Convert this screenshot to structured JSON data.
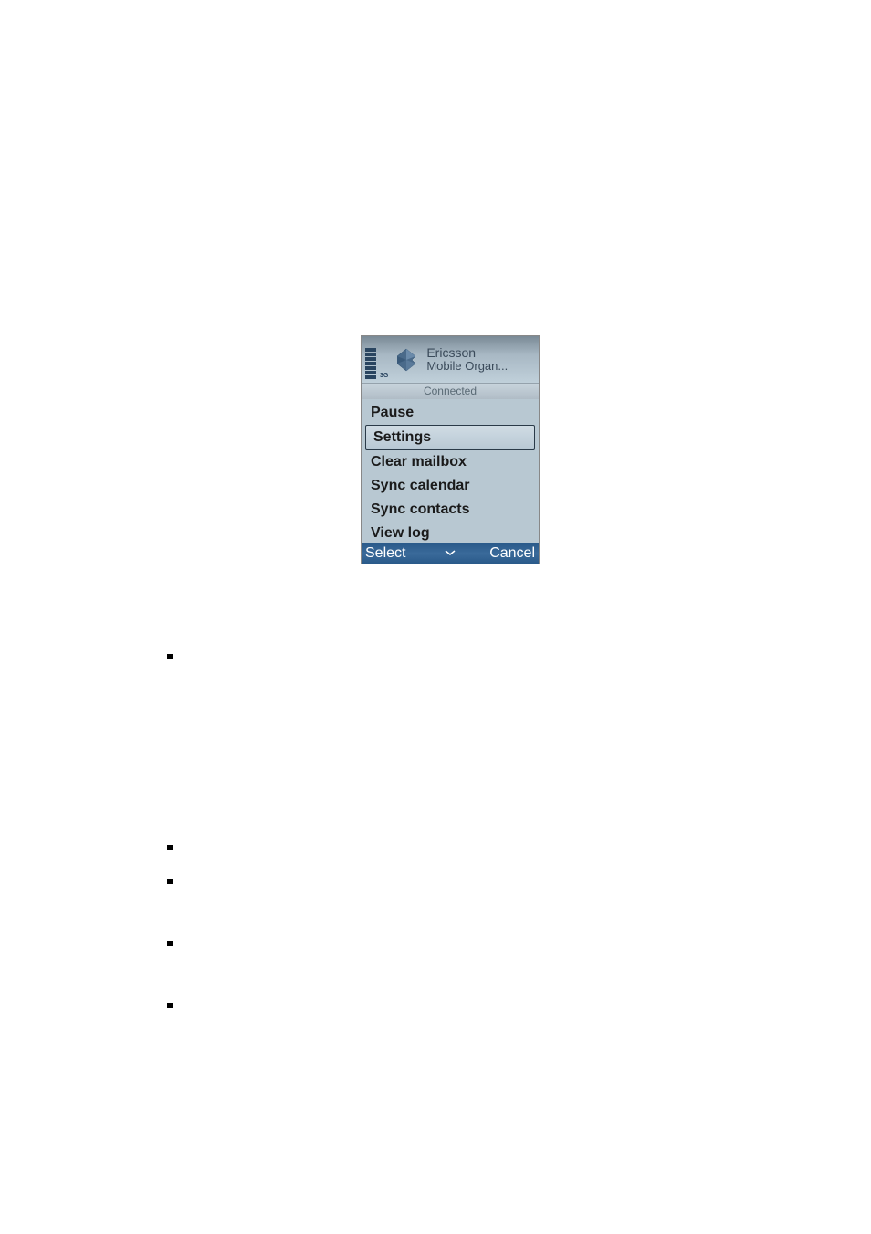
{
  "header": {
    "app_name_line1": "Ericsson",
    "app_name_line2": "Mobile Organ...",
    "network_label": "3G"
  },
  "connection_status": "Connected",
  "menu": {
    "items": [
      {
        "label": "Pause",
        "selected": false
      },
      {
        "label": "Settings",
        "selected": true
      },
      {
        "label": "Clear mailbox",
        "selected": false
      },
      {
        "label": "Sync calendar",
        "selected": false
      },
      {
        "label": "Sync contacts",
        "selected": false
      },
      {
        "label": "View log",
        "selected": false
      }
    ]
  },
  "softkeys": {
    "left": "Select",
    "center_icon": "chevron-down",
    "right": "Cancel"
  }
}
